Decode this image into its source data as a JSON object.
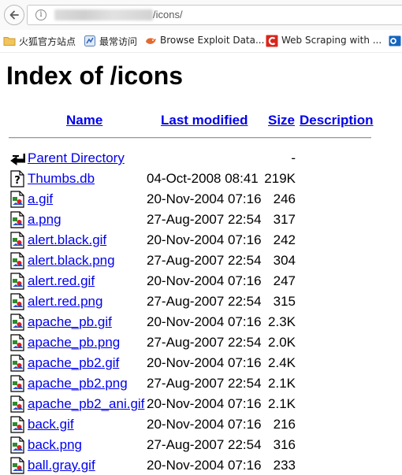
{
  "browser": {
    "url_path": "/icons/",
    "bookmarks": [
      {
        "label": "火狐官方站点",
        "icon": "folder-icon"
      },
      {
        "label": "最常访问",
        "icon": "most-visited-icon"
      },
      {
        "label": "Browse Exploit Data...",
        "icon": "exploit-db-icon"
      },
      {
        "label": "Web Scraping with ...",
        "icon": "web-scraping-icon"
      }
    ]
  },
  "page": {
    "title": "Index of /icons",
    "headers": {
      "name": "Name",
      "last_modified": "Last modified",
      "size": "Size",
      "description": "Description"
    },
    "parent": {
      "name": "Parent Directory",
      "size": "-"
    },
    "files": [
      {
        "name": "Thumbs.db",
        "date": "04-Oct-2008 08:41",
        "size": "219K",
        "icon": "unknown-file-icon"
      },
      {
        "name": "a.gif",
        "date": "20-Nov-2004 07:16",
        "size": "246",
        "icon": "image-file-icon"
      },
      {
        "name": "a.png",
        "date": "27-Aug-2007 22:54",
        "size": "317",
        "icon": "image-file-icon"
      },
      {
        "name": "alert.black.gif",
        "date": "20-Nov-2004 07:16",
        "size": "242",
        "icon": "image-file-icon"
      },
      {
        "name": "alert.black.png",
        "date": "27-Aug-2007 22:54",
        "size": "304",
        "icon": "image-file-icon"
      },
      {
        "name": "alert.red.gif",
        "date": "20-Nov-2004 07:16",
        "size": "247",
        "icon": "image-file-icon"
      },
      {
        "name": "alert.red.png",
        "date": "27-Aug-2007 22:54",
        "size": "315",
        "icon": "image-file-icon"
      },
      {
        "name": "apache_pb.gif",
        "date": "20-Nov-2004 07:16",
        "size": "2.3K",
        "icon": "image-file-icon"
      },
      {
        "name": "apache_pb.png",
        "date": "27-Aug-2007 22:54",
        "size": "2.0K",
        "icon": "image-file-icon"
      },
      {
        "name": "apache_pb2.gif",
        "date": "20-Nov-2004 07:16",
        "size": "2.4K",
        "icon": "image-file-icon"
      },
      {
        "name": "apache_pb2.png",
        "date": "27-Aug-2007 22:54",
        "size": "2.1K",
        "icon": "image-file-icon"
      },
      {
        "name": "apache_pb2_ani.gif",
        "date": "20-Nov-2004 07:16",
        "size": "2.1K",
        "icon": "image-file-icon"
      },
      {
        "name": "back.gif",
        "date": "20-Nov-2004 07:16",
        "size": "216",
        "icon": "image-file-icon"
      },
      {
        "name": "back.png",
        "date": "27-Aug-2007 22:54",
        "size": "316",
        "icon": "image-file-icon"
      },
      {
        "name": "ball.gray.gif",
        "date": "20-Nov-2004 07:16",
        "size": "233",
        "icon": "image-file-icon"
      }
    ]
  }
}
